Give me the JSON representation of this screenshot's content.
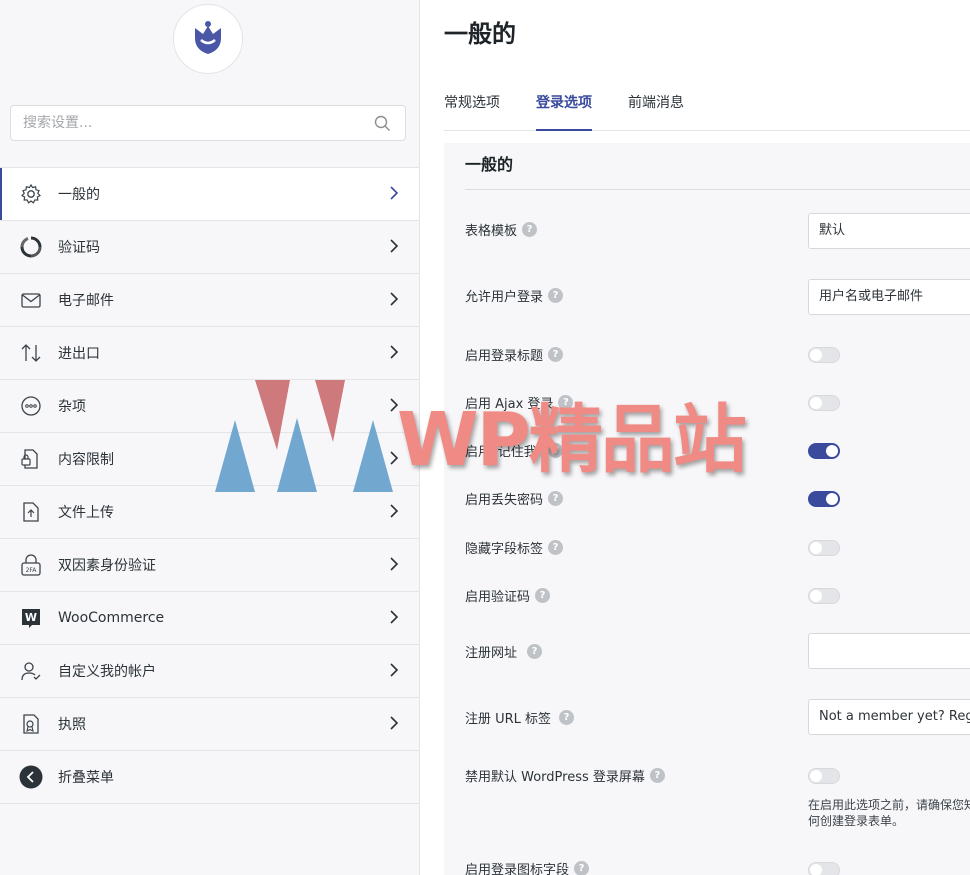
{
  "colors": {
    "accent": "#3a4a9c",
    "sidebar_bg": "#f7f7f9",
    "panel_bg": "#f7f7f9"
  },
  "sidebar": {
    "logo_icon": "tulip-logo-icon",
    "search_placeholder": "搜索设置...",
    "items": [
      {
        "label": "一般的",
        "icon": "gear-icon",
        "active": true
      },
      {
        "label": "验证码",
        "icon": "recaptcha-icon"
      },
      {
        "label": "电子邮件",
        "icon": "mail-icon"
      },
      {
        "label": "进出口",
        "icon": "import-export-icon"
      },
      {
        "label": "杂项",
        "icon": "more-icon"
      },
      {
        "label": "内容限制",
        "icon": "content-restriction-icon"
      },
      {
        "label": "文件上传",
        "icon": "file-upload-icon"
      },
      {
        "label": "双因素身份验证",
        "icon": "2fa-lock-icon",
        "badge": "2FA"
      },
      {
        "label": "WooCommerce",
        "icon": "woocommerce-icon",
        "badge": "W"
      },
      {
        "label": "自定义我的帐户",
        "icon": "user-check-icon"
      },
      {
        "label": "执照",
        "icon": "license-icon"
      },
      {
        "label": "折叠菜单",
        "icon": "collapse-icon"
      }
    ]
  },
  "main": {
    "title": "一般的",
    "tabs": [
      {
        "label": "常规选项"
      },
      {
        "label": "登录选项",
        "active": true
      },
      {
        "label": "前端消息"
      }
    ],
    "section_title": "一般的",
    "settings": {
      "form_template": {
        "label": "表格模板",
        "value": "默认"
      },
      "allow_login": {
        "label": "允许用户登录",
        "value": "用户名或电子邮件"
      },
      "login_title": {
        "label": "启用登录标题",
        "on": false
      },
      "ajax_login": {
        "label": "启用 Ajax 登录",
        "on": false
      },
      "remember_me": {
        "label": "启用“记住我”",
        "on": true
      },
      "lost_password": {
        "label": "启用丢失密码",
        "on": true
      },
      "hide_labels": {
        "label": "隐藏字段标签",
        "on": false
      },
      "captcha": {
        "label": "启用验证码",
        "on": false
      },
      "register_url": {
        "label": "注册网址",
        "value": ""
      },
      "register_url_label": {
        "label": "注册 URL 标签",
        "value": "Not a member yet? Register now"
      },
      "disable_wp_login": {
        "label": "禁用默认 WordPress 登录屏幕",
        "on": false,
        "note": "在启用此选项之前，请确保您知道如何创建登录表单。"
      },
      "login_icon_field": {
        "label": "启用登录图标字段",
        "on": false
      }
    },
    "help_glyph": "?"
  },
  "watermark": {
    "text": "WP精品站"
  }
}
